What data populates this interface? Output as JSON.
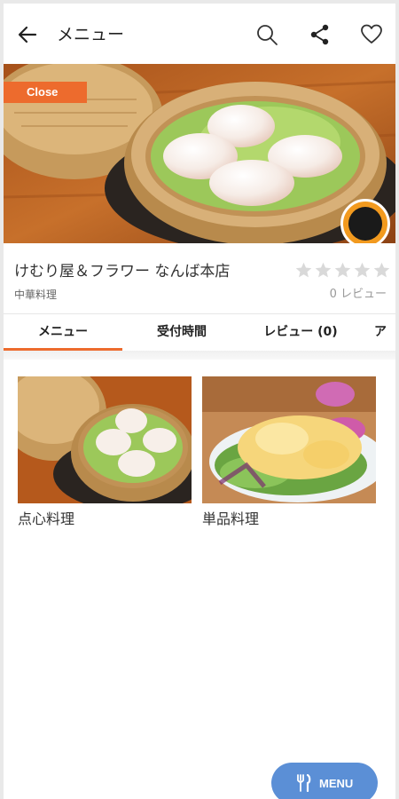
{
  "header": {
    "title": "メニュー",
    "icons": [
      "back-arrow-icon",
      "search-icon",
      "share-icon",
      "heart-icon"
    ]
  },
  "hero": {
    "status_tag": "Close",
    "image": "steamed shrimp dumplings in a bamboo steamer"
  },
  "shop": {
    "name": "けむり屋＆フラワー なんば本店",
    "category": "中華料理",
    "rating_stars": 0,
    "rating_max": 5,
    "review_count_label": "0 レビュー"
  },
  "tabs": [
    {
      "label": "メニュー",
      "active": true
    },
    {
      "label": "受付時間",
      "active": false
    },
    {
      "label": "レビュー (0)",
      "active": false
    },
    {
      "label": "ア",
      "active": false
    }
  ],
  "menu_categories": [
    {
      "label": "点心料理",
      "image": "dim sum in bamboo steamer"
    },
    {
      "label": "単品料理",
      "image": "mayonnaise shrimp with lettuce"
    }
  ],
  "fab": {
    "label": "MENU",
    "icon": "fork-knife-icon"
  },
  "colors": {
    "accent": "#ed6b2d",
    "fab": "#5b8fd6",
    "star_empty": "#d9d9d9"
  }
}
